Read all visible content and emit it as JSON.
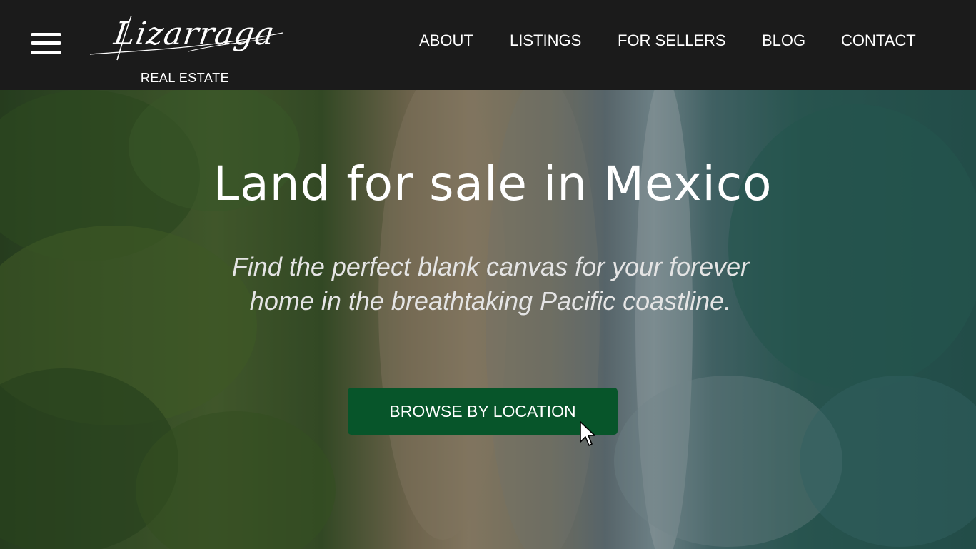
{
  "brand": {
    "wordmark": "Lizarraga",
    "subtitle": "REAL ESTATE"
  },
  "header": {
    "menu_icon": "hamburger-menu-icon",
    "background_color": "#1b1b1b"
  },
  "nav": {
    "items": [
      {
        "label": "ABOUT"
      },
      {
        "label": "LISTINGS"
      },
      {
        "label": "FOR SELLERS"
      },
      {
        "label": "BLOG"
      },
      {
        "label": "CONTACT"
      }
    ]
  },
  "hero": {
    "title": "Land for sale in Mexico",
    "subtitle_line1": "Find the perfect blank canvas for your forever",
    "subtitle_line2": "home in the breathtaking Pacific coastline.",
    "cta_label": "BROWSE BY LOCATION",
    "cta_color": "#07552a"
  },
  "cursor": {
    "icon": "mouse-pointer-icon"
  }
}
